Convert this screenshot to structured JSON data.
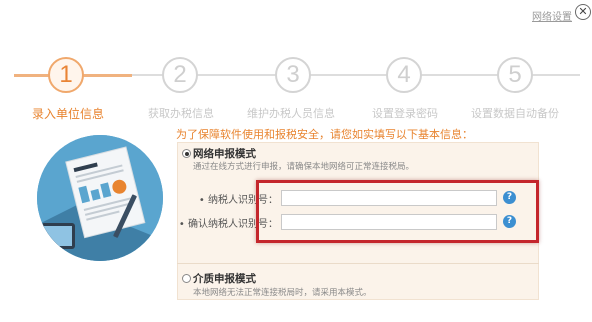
{
  "header": {
    "network_settings_label": "网络设置",
    "close_symbol": "✕"
  },
  "steps": [
    {
      "number": "1",
      "label": "录入单位信息",
      "active": true
    },
    {
      "number": "2",
      "label": "获取办税信息",
      "active": false
    },
    {
      "number": "3",
      "label": "维护办税人员信息",
      "active": false
    },
    {
      "number": "4",
      "label": "设置登录密码",
      "active": false
    },
    {
      "number": "5",
      "label": "设置数据自动备份",
      "active": false
    }
  ],
  "notice": "为了保障软件使用和报税安全，请您如实填写以下基本信息：",
  "network_mode": {
    "title": "网络申报模式",
    "description": "通过在线方式进行申报，请确保本地网络可正常连接税局。",
    "selected": true,
    "fields": [
      {
        "label": "• 纳税人识别号：",
        "value": ""
      },
      {
        "label": "• 确认纳税人识别号：",
        "value": ""
      }
    ],
    "help_symbol": "?"
  },
  "media_mode": {
    "title": "介质申报模式",
    "description": "本地网络无法正常连接税局时，请采用本模式。",
    "selected": false
  },
  "colors": {
    "accent": "#e8842f",
    "highlight_border": "#c4262c",
    "help": "#3c8fd1",
    "panel_bg": "#fbf3ea"
  }
}
